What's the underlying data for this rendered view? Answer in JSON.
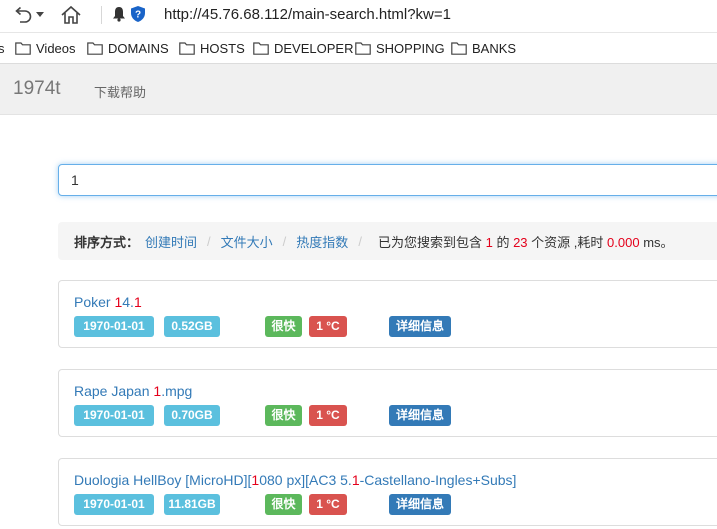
{
  "browser": {
    "url": "http://45.76.68.112/main-search.html?kw=1"
  },
  "bookmarks": [
    {
      "label": "s"
    },
    {
      "label": "Videos"
    },
    {
      "label": "DOMAINS"
    },
    {
      "label": "HOSTS"
    },
    {
      "label": "DEVELOPER"
    },
    {
      "label": "SHOPPING"
    },
    {
      "label": "BANKS"
    }
  ],
  "site": {
    "brand": "1974t",
    "nav_link": "下载帮助"
  },
  "search": {
    "value": "1"
  },
  "sort": {
    "label": "排序方式：",
    "options": [
      "创建时间",
      "文件大小",
      "热度指数"
    ],
    "info_prefix": "已为您搜索到包含",
    "keyword": "1",
    "info_mid": "的",
    "count": "23",
    "info_mid2": "个资源 ,耗时",
    "time": "0.000",
    "info_suffix": "ms。"
  },
  "results": [
    {
      "title_parts": [
        {
          "text": "Poker ",
          "hl": false
        },
        {
          "text": "1",
          "hl": true
        },
        {
          "text": "4.",
          "hl": false
        },
        {
          "text": "1",
          "hl": true
        }
      ],
      "date": "1970-01-01",
      "size": "0.52GB",
      "speed": "很快",
      "temp": "1 °C",
      "detail": "详细信息"
    },
    {
      "title_parts": [
        {
          "text": "Rape Japan ",
          "hl": false
        },
        {
          "text": "1",
          "hl": true
        },
        {
          "text": ".mpg",
          "hl": false
        }
      ],
      "date": "1970-01-01",
      "size": "0.70GB",
      "speed": "很快",
      "temp": "1 °C",
      "detail": "详细信息"
    },
    {
      "title_parts": [
        {
          "text": "Duologia HellBoy [MicroHD][",
          "hl": false
        },
        {
          "text": "1",
          "hl": true
        },
        {
          "text": "080 px][AC3 5.",
          "hl": false
        },
        {
          "text": "1",
          "hl": true
        },
        {
          "text": "-Castellano-Ingles+Subs]",
          "hl": false
        }
      ],
      "date": "1970-01-01",
      "size": "11.81GB",
      "speed": "很快",
      "temp": "1 °C",
      "detail": "详细信息"
    }
  ],
  "colors": {
    "link": "#337ab7",
    "highlight": "#e4001b",
    "info_badge": "#5bc0de",
    "success_badge": "#5cb85c",
    "danger_badge": "#d9534f",
    "primary_badge": "#337ab7"
  },
  "icons": {
    "back": "back-arrow-icon",
    "dropdown": "chevron-down-icon",
    "home": "home-icon",
    "secure": "shield-icon",
    "folder": "folder-icon"
  }
}
